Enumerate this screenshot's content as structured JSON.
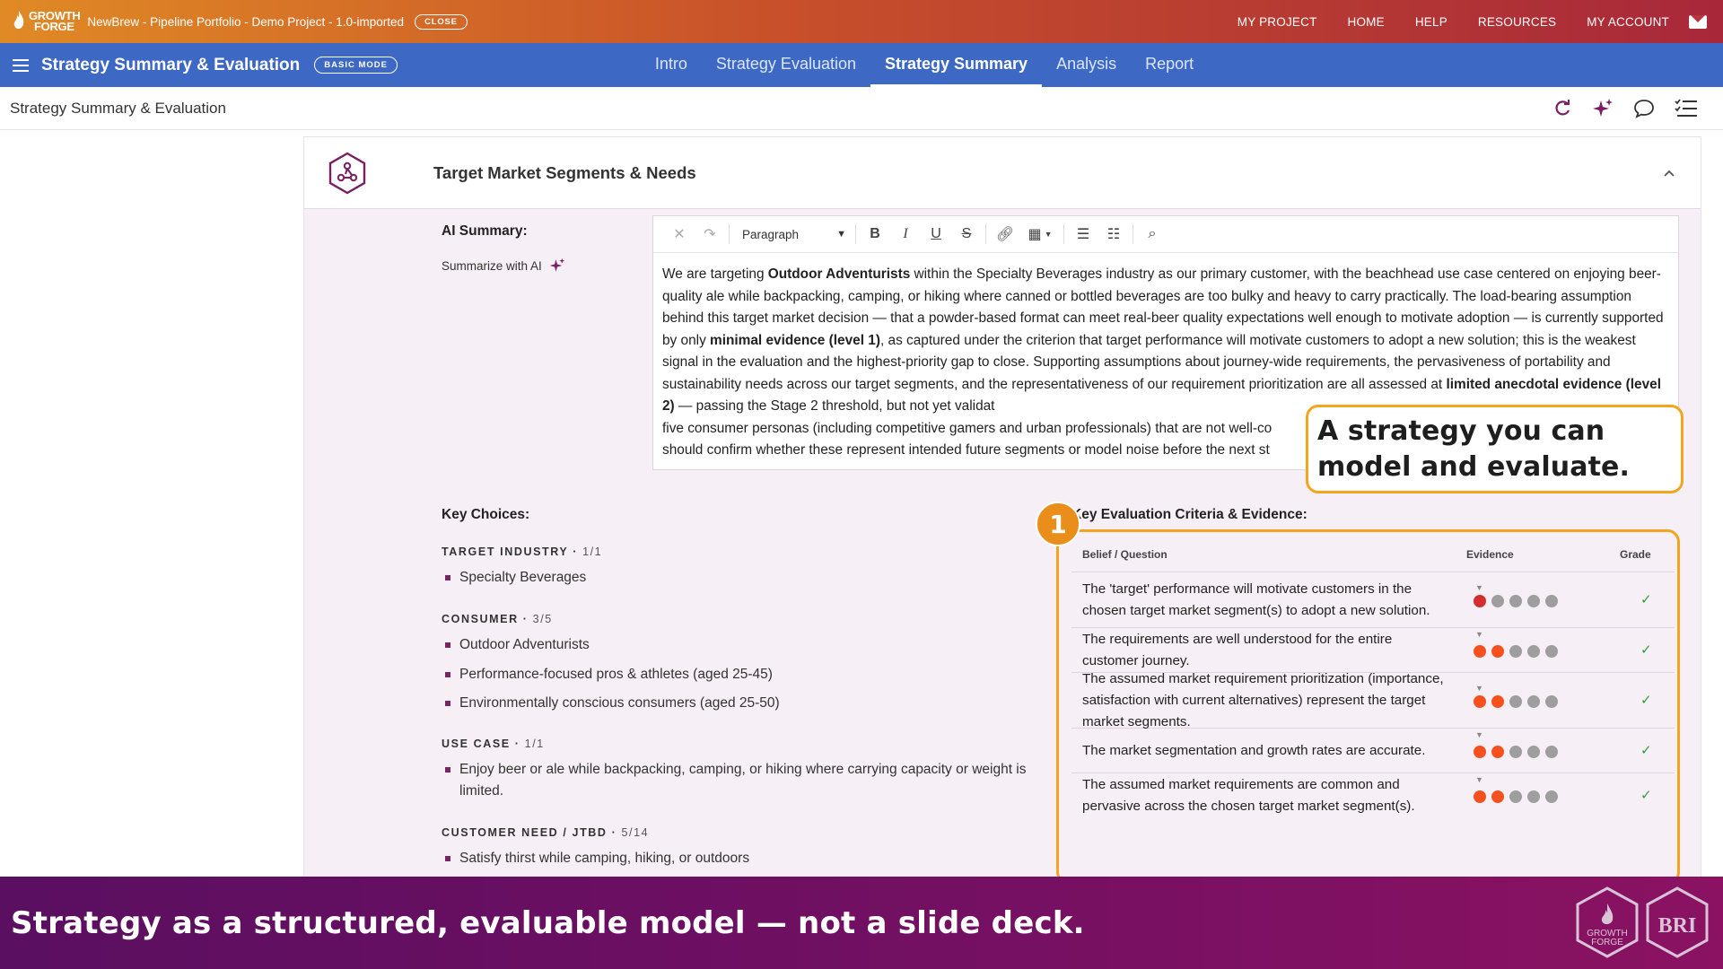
{
  "topbar": {
    "logo_text_1": "GROWTH",
    "logo_text_2": "FORGE",
    "project_title": "NewBrew - Pipeline Portfolio - Demo Project - 1.0-imported",
    "close_label": "CLOSE",
    "nav": [
      "MY PROJECT",
      "HOME",
      "HELP",
      "RESOURCES",
      "MY ACCOUNT"
    ]
  },
  "appbar": {
    "title": "Strategy Summary & Evaluation",
    "mode": "BASIC MODE",
    "tabs": [
      "Intro",
      "Strategy Evaluation",
      "Strategy Summary",
      "Analysis",
      "Report"
    ],
    "active_tab": "Strategy Summary"
  },
  "subheader": {
    "breadcrumb": "Strategy Summary & Evaluation",
    "tool_icons": [
      "refresh-icon",
      "sparkle-icon",
      "comment-icon",
      "checklist-icon"
    ]
  },
  "card": {
    "title": "Target Market Segments & Needs",
    "ai_label": "AI Summary:",
    "summarize_label": "Summarize with AI",
    "editor": {
      "paragraph_select": "Paragraph",
      "p1": "We are targeting ",
      "b1": "Outdoor Adventurists",
      "p2": " within the Specialty Beverages industry as our primary customer, with the beachhead use case centered on enjoying beer-quality ale while backpacking, camping, or hiking where canned or bottled beverages are too bulky and heavy to carry practically. The load-bearing assumption behind this target market decision — that a powder-based format can meet real-beer quality expectations well enough to motivate adoption — is currently supported by only ",
      "b2": "minimal evidence (level 1)",
      "p3": ", as captured under the criterion that target performance will motivate customers to adopt a new solution; this is the weakest signal in the evaluation and the highest-priority gap to close. Supporting assumptions about journey-wide requirements, the pervasiveness of portability and sustainability needs across our target segments, and the representativeness of our requirement prioritization are all assessed at ",
      "b3": "limited anecdotal evidence (level 2)",
      "p4": " — passing the Stage 2 threshold, but not yet validat",
      "p5": "five consumer personas (including competitive gamers and urban professionals) that are not well-co",
      "p6": "should confirm whether these represent intended future segments or model noise before the next st"
    },
    "key_choices_label": "Key Choices:",
    "sections": [
      {
        "label": "TARGET INDUSTRY",
        "count": "1/1",
        "items": [
          "Specialty Beverages"
        ]
      },
      {
        "label": "CONSUMER",
        "count": "3/5",
        "items": [
          "Outdoor Adventurists",
          "Performance-focused pros & athletes (aged 25-45)",
          "Environmentally conscious consumers (aged 25-50)"
        ]
      },
      {
        "label": "USE CASE",
        "count": "1/1",
        "items": [
          "Enjoy beer or ale while backpacking, camping, or hiking where carrying capacity or weight is limited."
        ]
      },
      {
        "label": "CUSTOMER NEED / JTBD",
        "count": "5/14",
        "items": [
          "Satisfy thirst while camping, hiking, or outdoors"
        ]
      }
    ],
    "evaluation": {
      "title": "Key Evaluation Criteria & Evidence:",
      "headers": [
        "Belief / Question",
        "Evidence",
        "Grade"
      ],
      "rows": [
        {
          "question": "The 'target' performance will motivate customers in the chosen target market segment(s) to adopt a new solution.",
          "evidence_level": 1,
          "grade": "✓"
        },
        {
          "question": "The requirements are well understood for the entire customer journey.",
          "evidence_level": 2,
          "grade": "✓"
        },
        {
          "question": "The assumed market requirement prioritization (importance, satisfaction with current alternatives) represent the target market segments.",
          "evidence_level": 2,
          "grade": "✓"
        },
        {
          "question": "The market segmentation and growth rates are accurate.",
          "evidence_level": 2,
          "grade": "✓"
        },
        {
          "question": "The assumed market requirements are common and pervasive across the chosen target market segment(s).",
          "evidence_level": 2,
          "grade": "✓"
        }
      ],
      "colors": {
        "level1": "#d32f2f",
        "level2": "#f4511e",
        "empty": "#9e9e9e"
      }
    }
  },
  "callout": {
    "text": "A strategy you can model and evaluate.",
    "number": "1"
  },
  "banner": {
    "text": "Strategy as a structured, evaluable model — not a slide deck.",
    "logo_1_line1": "GROWTH",
    "logo_1_line2": "FORGE",
    "logo_2": "BRI"
  },
  "colors": {
    "accent_blue": "#3d68c4",
    "highlight_orange": "#f3a51f",
    "banner_purple": "#6c0f62"
  }
}
